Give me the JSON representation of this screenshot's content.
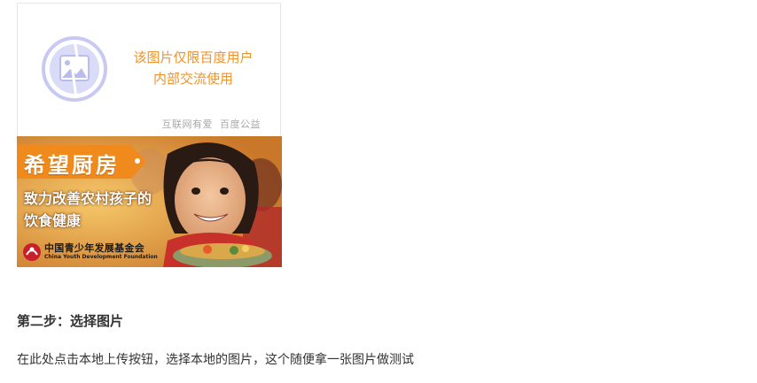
{
  "placeholder": {
    "icon": "image-placeholder-icon",
    "message_line1": "该图片仅限百度用户",
    "message_line2": "内部交流使用",
    "footer_left": "互联网有爱",
    "footer_right": "百度公益",
    "accent_color": "#f0932b",
    "icon_color": "#c7c9f2"
  },
  "banner": {
    "title": "希望厨房",
    "slogan_line1": "致力改善农村孩子的",
    "slogan_line2": "饮食健康",
    "foundation_cn": "中国青少年发展基金会",
    "foundation_en": "China Youth Development Foundation",
    "tag_color": "#f08a1c"
  },
  "article": {
    "step_heading": "第二步：选择图片",
    "step_desc": "在此处点击本地上传按钮，选择本地的图片，这个随便拿一张图片做测试"
  }
}
